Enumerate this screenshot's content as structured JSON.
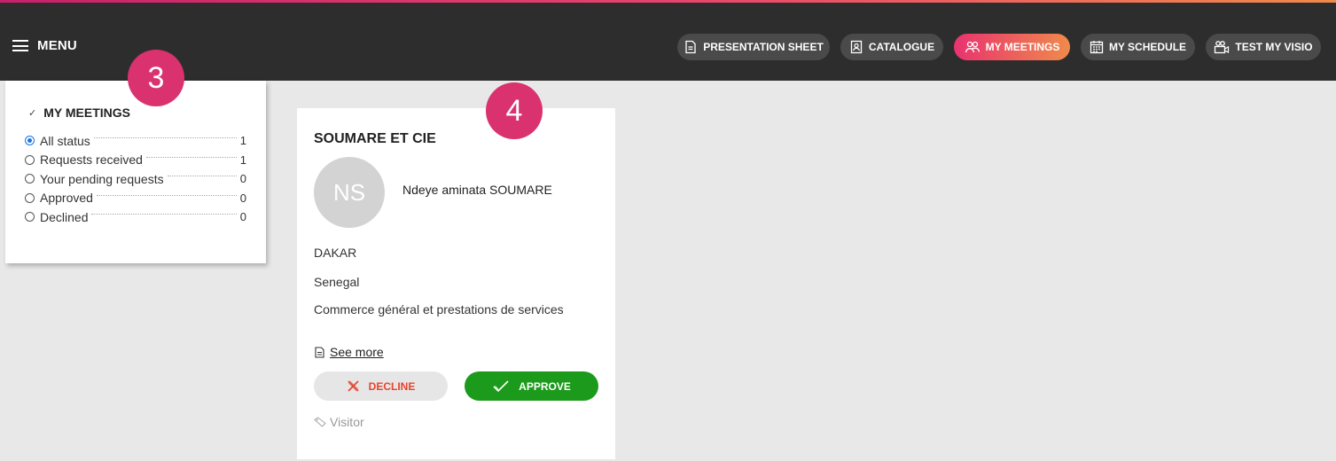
{
  "header": {
    "menu_label": "MENU",
    "nav": [
      {
        "label": "PRESENTATION SHEET",
        "icon": "document-icon",
        "active": false
      },
      {
        "label": "CATALOGUE",
        "icon": "contact-book-icon",
        "active": false
      },
      {
        "label": "MY MEETINGS",
        "icon": "people-icon",
        "active": true
      },
      {
        "label": "MY SCHEDULE",
        "icon": "calendar-icon",
        "active": false
      },
      {
        "label": "TEST MY VISIO",
        "icon": "video-people-icon",
        "active": false
      }
    ]
  },
  "annotations": {
    "first": "3",
    "second": "4"
  },
  "filters": {
    "title": "MY MEETINGS",
    "items": [
      {
        "label": "All status",
        "count": "1",
        "selected": true
      },
      {
        "label": "Requests received",
        "count": "1",
        "selected": false
      },
      {
        "label": "Your pending requests",
        "count": "0",
        "selected": false
      },
      {
        "label": "Approved",
        "count": "0",
        "selected": false
      },
      {
        "label": "Declined",
        "count": "0",
        "selected": false
      }
    ]
  },
  "card": {
    "company": "SOUMARE ET CIE",
    "initials": "NS",
    "person": "Ndeye aminata SOUMARE",
    "city": "DAKAR",
    "country": "Senegal",
    "activity": "Commerce général et prestations de services",
    "see_more": "See more",
    "decline_label": "DECLINE",
    "approve_label": "APPROVE",
    "role": "Visitor"
  },
  "colors": {
    "topbar": "#2d2d2d",
    "accent": "#d9326e",
    "approve": "#1c9a1c",
    "decline_text": "#e8432d"
  }
}
